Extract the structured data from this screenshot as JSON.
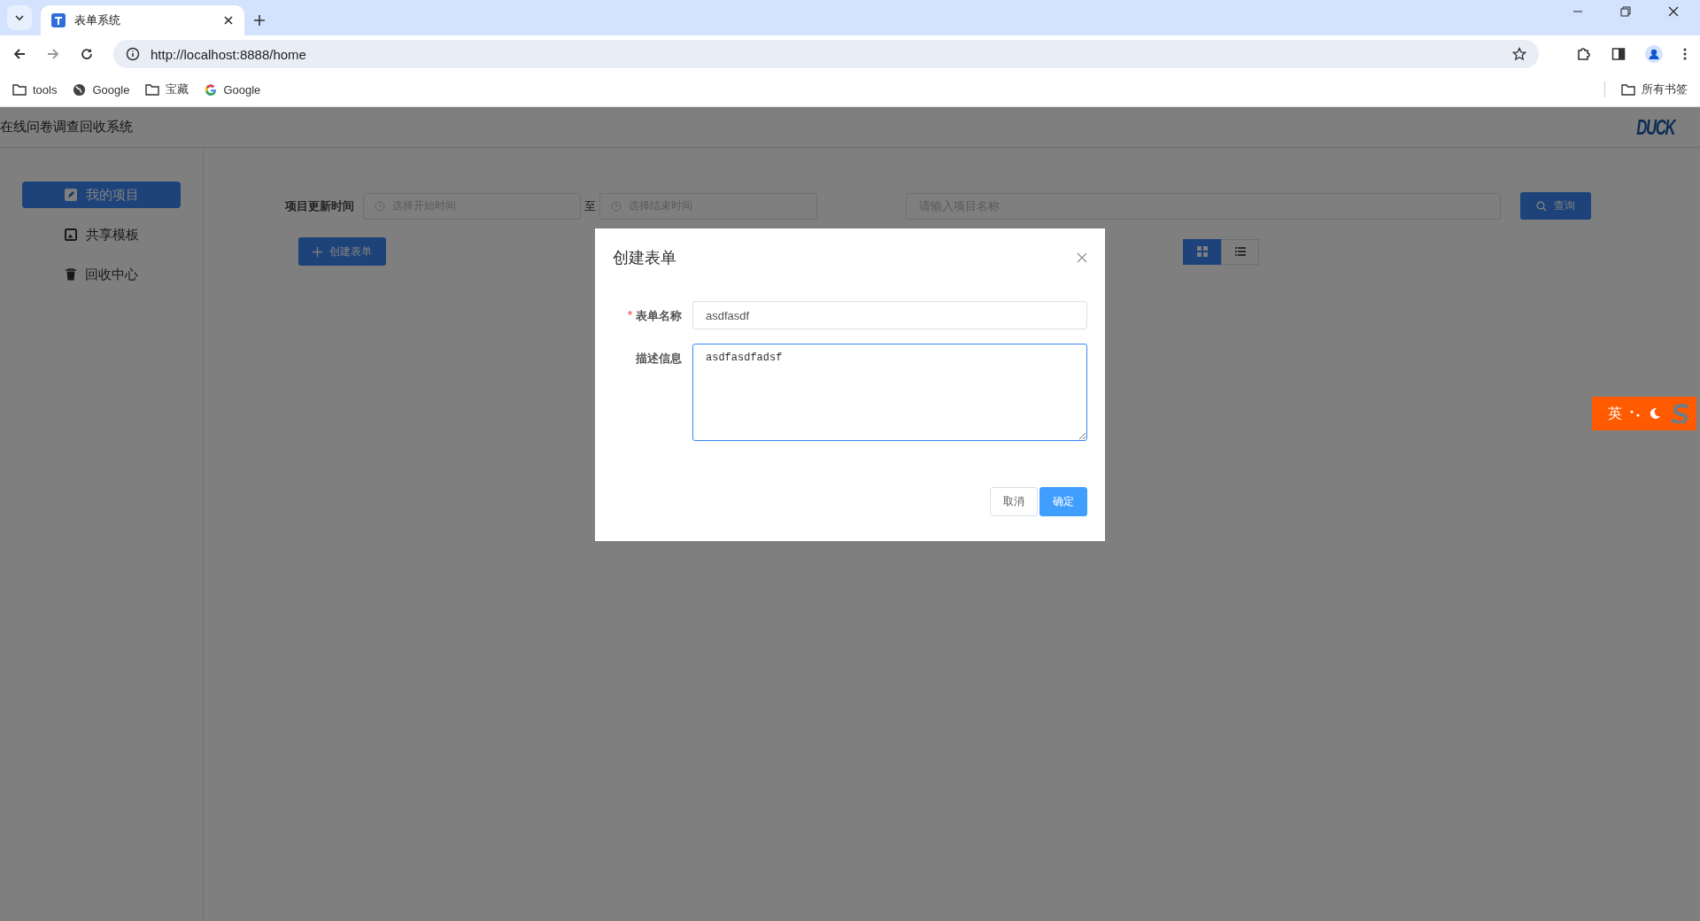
{
  "browser": {
    "tab_title": "表单系统",
    "url": "http://localhost:8888/home",
    "bookmarks": [
      {
        "kind": "folder",
        "label": "tools"
      },
      {
        "kind": "globe",
        "label": "Google"
      },
      {
        "kind": "folder",
        "label": "宝藏"
      },
      {
        "kind": "google",
        "label": "Google"
      }
    ],
    "all_bookmarks": "所有书签"
  },
  "app": {
    "title": "在线问卷调查回收系统",
    "logo": "DUCK"
  },
  "sidebar": {
    "items": [
      {
        "kind": "edit",
        "label": "我的项目",
        "selected": true
      },
      {
        "kind": "template",
        "label": "共享模板",
        "selected": false
      },
      {
        "kind": "trash",
        "label": "回收中心",
        "selected": false
      }
    ]
  },
  "filters": {
    "date_label": "项目更新时间",
    "start_placeholder": "选择开始时间",
    "separator": "至",
    "end_placeholder": "选择结束时间",
    "name_placeholder": "请输入项目名称",
    "search_button": "查询",
    "create_button": "创建表单"
  },
  "view_toggle": [
    {
      "kind": "grid",
      "selected": true
    },
    {
      "kind": "list",
      "selected": false
    }
  ],
  "dialog": {
    "title": "创建表单",
    "fields": [
      {
        "kind": "input",
        "required_mark": "*",
        "label": "表单名称",
        "value": "asdfasdf"
      },
      {
        "kind": "textarea",
        "label": "描述信息",
        "value": "asdfasdfadsf"
      }
    ],
    "buttons": [
      {
        "kind": "default",
        "label": "取消"
      },
      {
        "kind": "primary",
        "label": "确定"
      }
    ]
  },
  "ime": {
    "mode": "英"
  }
}
